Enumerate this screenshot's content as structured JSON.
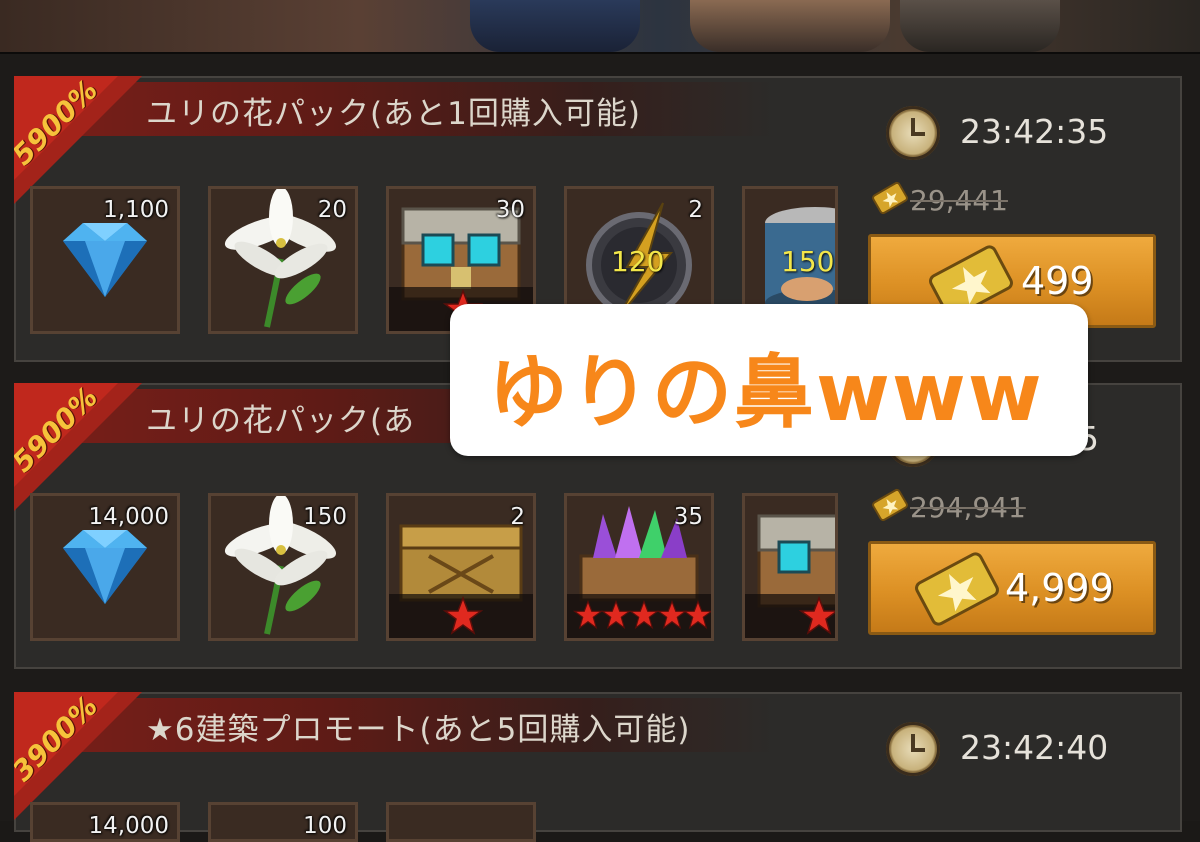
{
  "packs": [
    {
      "title": "ユリの花パック(あと1回購入可能)",
      "bonus": "5900%",
      "timer": "23:42:35",
      "old_price": "29,441",
      "price": "499",
      "items": [
        {
          "icon": "diamond-icon",
          "count": "1,100"
        },
        {
          "icon": "lily-icon",
          "count": "20"
        },
        {
          "icon": "chest-icon",
          "count": "30",
          "stars": 1
        },
        {
          "icon": "speedup-icon",
          "count": "2",
          "badge": "120"
        },
        {
          "icon": "food-can-icon",
          "count": "",
          "badge": "150"
        }
      ]
    },
    {
      "title": "ユリの花パック(あ",
      "bonus": "5900%",
      "timer": "5",
      "old_price": "294,941",
      "price": "4,999",
      "items": [
        {
          "icon": "diamond-icon",
          "count": "14,000"
        },
        {
          "icon": "lily-icon",
          "count": "150"
        },
        {
          "icon": "wooden-crate-icon",
          "count": "2",
          "stars": 1
        },
        {
          "icon": "crystal-chest-icon",
          "count": "35",
          "stars": 5
        },
        {
          "icon": "chest-icon",
          "count": "",
          "stars": 1
        }
      ]
    },
    {
      "title": "★6建築プロモート(あと5回購入可能)",
      "bonus": "3900%",
      "timer": "23:42:40",
      "items": [
        {
          "icon": "diamond-icon",
          "count": "14,000"
        },
        {
          "icon": "lily-icon",
          "count": "100"
        },
        {
          "icon": "chest-icon",
          "count": ""
        }
      ]
    }
  ],
  "overlay": {
    "caption": "ゆりの鼻www"
  },
  "colors": {
    "accent": "#f7871a",
    "button": "#e39a2e",
    "ribbon": "#a3231a",
    "bonus": "#f6c23b"
  }
}
